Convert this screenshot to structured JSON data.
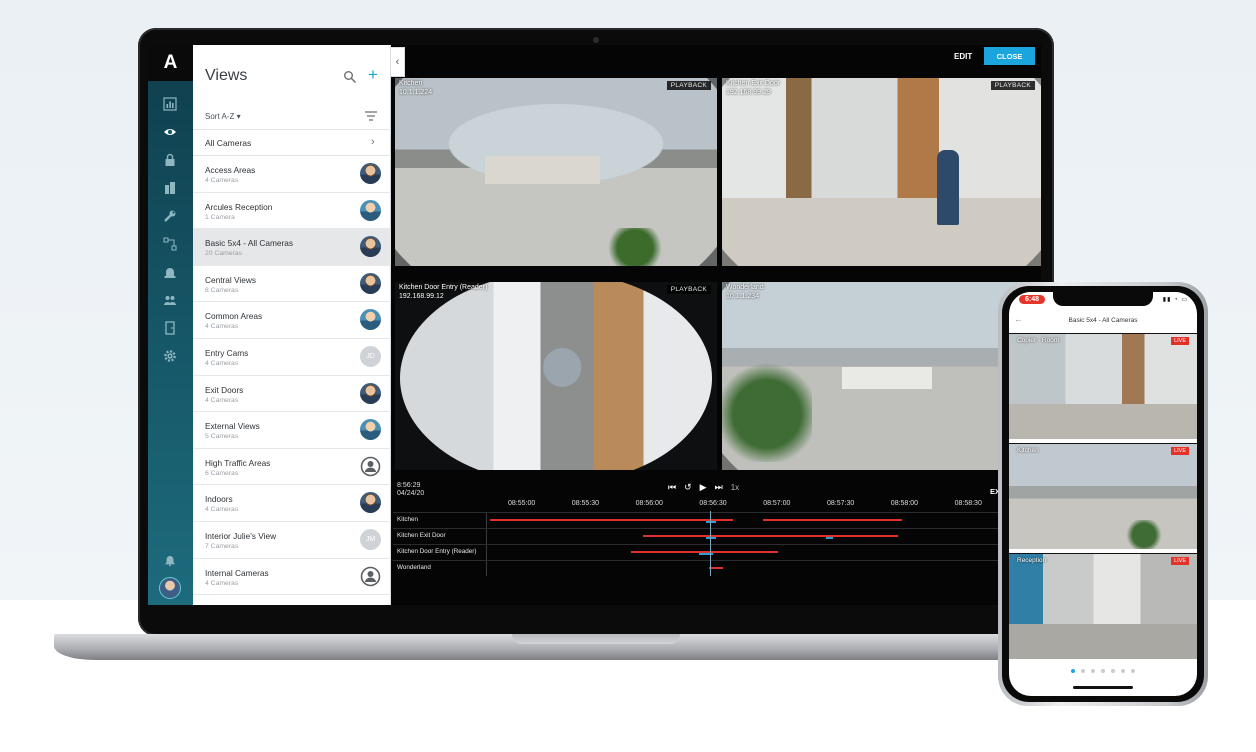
{
  "app": {
    "logo": "A",
    "views_title": "Views",
    "sort_label": "Sort A-Z",
    "all_cameras_label": "All Cameras",
    "edit_label": "EDIT",
    "close_label": "CLOSE"
  },
  "rail_icons": [
    "dashboard-icon",
    "eye-icon",
    "lock-icon",
    "building-icon",
    "wrench-icon",
    "flow-icon",
    "alarm-icon",
    "users-icon",
    "door-icon",
    "gear-icon",
    "bell-icon"
  ],
  "views": [
    {
      "name": "Access Areas",
      "count": "4 Cameras",
      "avatar": "photo"
    },
    {
      "name": "Arcules Reception",
      "count": "1 Camera",
      "avatar": "photo2"
    },
    {
      "name": "Basic 5x4 - All Cameras",
      "count": "20 Cameras",
      "avatar": "photo",
      "selected": true
    },
    {
      "name": "Central Views",
      "count": "8 Cameras",
      "avatar": "photo"
    },
    {
      "name": "Common Areas",
      "count": "4 Cameras",
      "avatar": "photo2"
    },
    {
      "name": "Entry Cams",
      "count": "4 Cameras",
      "avatar": "initials",
      "initials": "JD"
    },
    {
      "name": "Exit Doors",
      "count": "4 Cameras",
      "avatar": "photo"
    },
    {
      "name": "External Views",
      "count": "5 Cameras",
      "avatar": "photo2"
    },
    {
      "name": "High Traffic Areas",
      "count": "6 Cameras",
      "avatar": "generic"
    },
    {
      "name": "Indoors",
      "count": "4 Cameras",
      "avatar": "photo"
    },
    {
      "name": "Interior Julie's View",
      "count": "7 Cameras",
      "avatar": "initials",
      "initials": "JM"
    },
    {
      "name": "Internal Cameras",
      "count": "4 Cameras",
      "avatar": "generic"
    }
  ],
  "cameras": [
    {
      "name": "Kitchen",
      "ip": "10.1.1.224",
      "badge": "PLAYBACK"
    },
    {
      "name": "Kitchen Exit Door",
      "ip": "192.168.99.29",
      "badge": "PLAYBACK"
    },
    {
      "name": "Kitchen Door Entry (Reader)",
      "ip": "192.168.99.12",
      "badge": "PLAYBACK"
    },
    {
      "name": "Wonderland",
      "ip": "10.1.1.234",
      "badge": "PLAYBACK"
    }
  ],
  "timeline": {
    "time": "8:56:29",
    "date": "04/24/20",
    "speed": "1x",
    "export_label": "EX",
    "ticks": [
      "08:55:00",
      "08:55:30",
      "08:56:00",
      "08:56:30",
      "08:57:00",
      "08:57:30",
      "08:58:00",
      "08:58:30"
    ],
    "rows": [
      {
        "label": "Kitchen"
      },
      {
        "label": "Kitchen Exit Door"
      },
      {
        "label": "Kitchen Door Entry (Reader)"
      },
      {
        "label": "Wonderland"
      }
    ],
    "colors": {
      "recording": "#e0302a",
      "motion": "#2a9fd8"
    }
  },
  "phone": {
    "time": "6:48",
    "title": "Basic 5x4 - All Cameras",
    "live_label": "LIVE",
    "tiles": [
      {
        "name": "Copier - Room"
      },
      {
        "name": "Kitchen"
      },
      {
        "name": "Reception"
      }
    ],
    "page_count": 7,
    "active_page": 1
  },
  "colors": {
    "accent": "#1ba5dc",
    "rail": "#175a6b",
    "live": "#e2332a"
  }
}
